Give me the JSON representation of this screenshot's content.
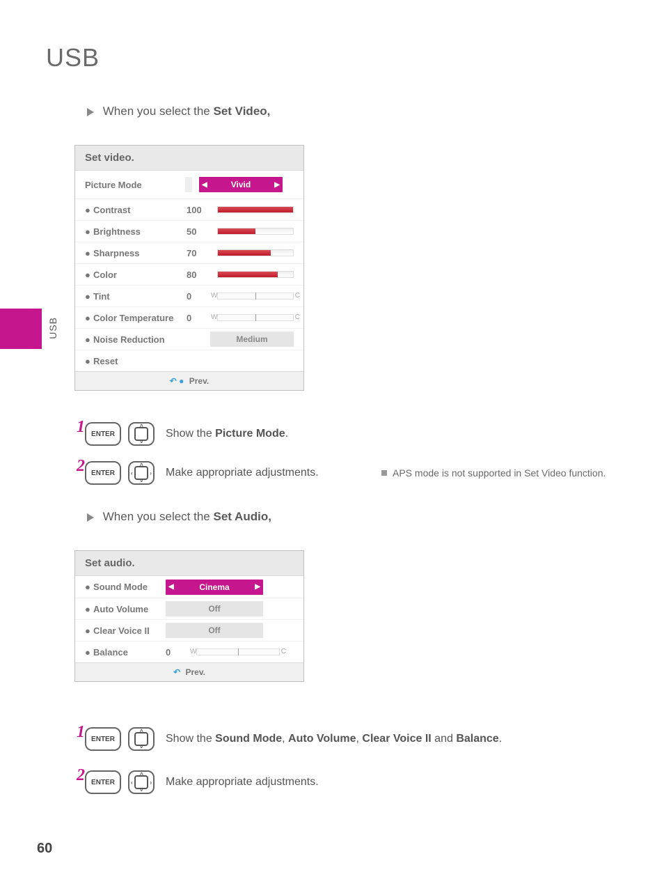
{
  "page": {
    "title": "USB",
    "side_label": "USB",
    "number": "60"
  },
  "intro_video": {
    "prefix": "When you select the ",
    "bold": "Set Video,"
  },
  "intro_audio": {
    "prefix": "When you select the ",
    "bold": "Set Audio,"
  },
  "video_panel": {
    "header": "Set video.",
    "picture_mode_label": "Picture Mode",
    "picture_mode_value": "Vivid",
    "rows": {
      "contrast": {
        "label": "Contrast",
        "value": "100",
        "fill": 100
      },
      "brightness": {
        "label": "Brightness",
        "value": "50",
        "fill": 50
      },
      "sharpness": {
        "label": "Sharpness",
        "value": "70",
        "fill": 70
      },
      "color": {
        "label": "Color",
        "value": "80",
        "fill": 80
      },
      "tint": {
        "label": "Tint",
        "value": "0"
      },
      "color_temp": {
        "label": "Color Temperature",
        "value": "0"
      },
      "noise": {
        "label": "Noise Reduction",
        "value": "Medium"
      },
      "reset": {
        "label": "Reset"
      }
    },
    "footer": "Prev."
  },
  "audio_panel": {
    "header": "Set audio.",
    "rows": {
      "sound_mode": {
        "label": "Sound Mode",
        "value": "Cinema"
      },
      "auto_volume": {
        "label": "Auto Volume",
        "value": "Off"
      },
      "clear_voice": {
        "label": "Clear Voice II",
        "value": "Off"
      },
      "balance": {
        "label": "Balance",
        "value": "0"
      }
    },
    "footer": "Prev."
  },
  "keys": {
    "enter": "ENTER"
  },
  "steps": {
    "v1_prefix": "Show the ",
    "v1_bold": "Picture Mode",
    "v1_suffix": ".",
    "v2": "Make appropriate adjustments.",
    "a1_prefix": "Show the ",
    "a1_b1": "Sound Mode",
    "a1_s1": ", ",
    "a1_b2": "Auto Volume",
    "a1_s2": ", ",
    "a1_b3": "Clear Voice II",
    "a1_s3": " and ",
    "a1_b4": "Balance",
    "a1_suffix": ".",
    "a2": "Make appropriate adjustments."
  },
  "note": "APS mode is not supported in Set Video function.",
  "nums": {
    "one": "1",
    "two": "2"
  }
}
